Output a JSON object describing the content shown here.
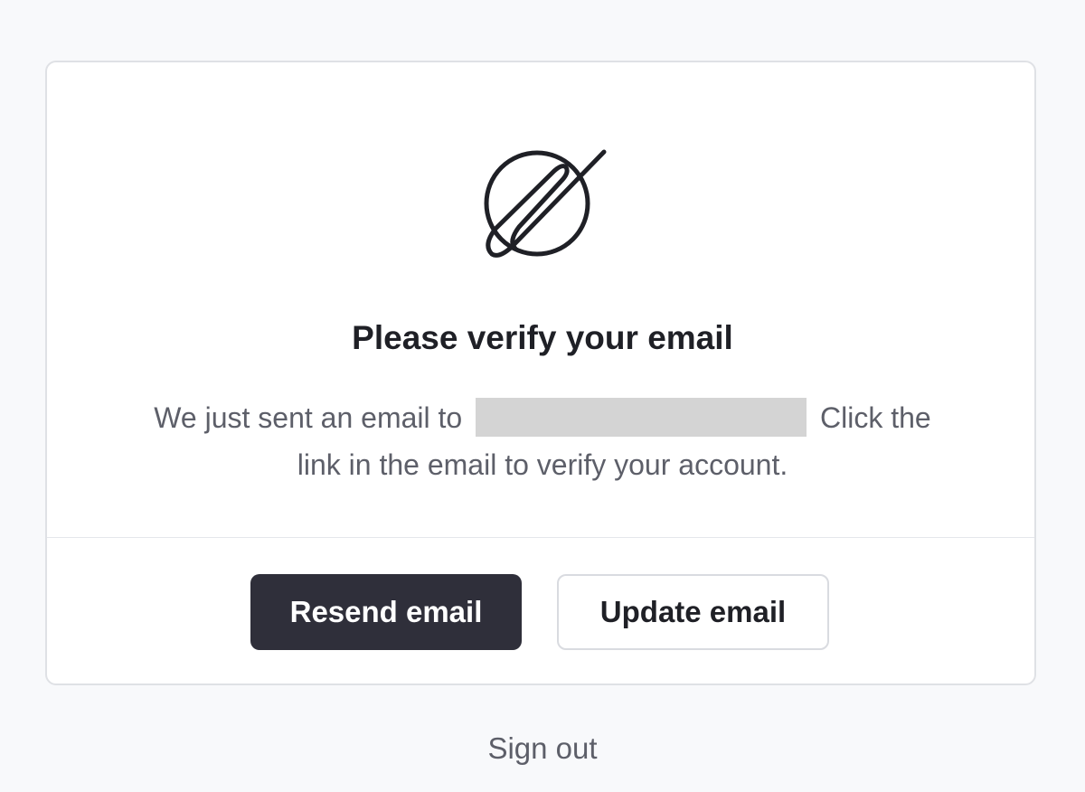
{
  "verification_card": {
    "logo": "logo-icon",
    "title": "Please verify your email",
    "message_prefix": "We just sent an email to",
    "message_suffix": "Click the link in the email to verify your account.",
    "resend_button_label": "Resend email",
    "update_button_label": "Update email"
  },
  "footer": {
    "sign_out_label": "Sign out"
  },
  "colors": {
    "primary_button": "#2f2f3a",
    "background": "#f8f9fb",
    "text_muted": "#5d5f69",
    "redaction": "#d4d4d4"
  }
}
